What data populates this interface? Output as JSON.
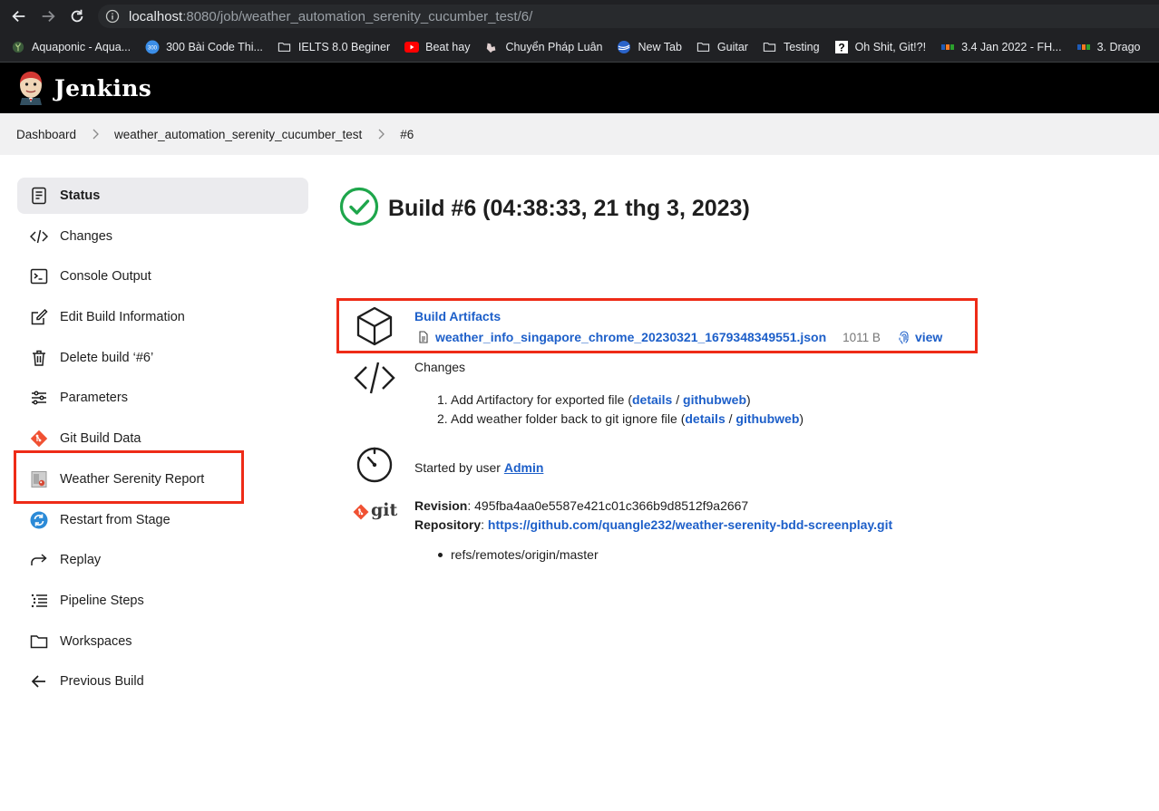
{
  "browser": {
    "url_host": "localhost",
    "url_rest": ":8080/job/weather_automation_serenity_cucumber_test/6/",
    "bookmarks": [
      {
        "label": "Aquaponic - Aqua...",
        "icon": "plant-icon"
      },
      {
        "label": "300 Bài Code Thi...",
        "icon": "300-badge-icon"
      },
      {
        "label": "IELTS 8.0 Beginer",
        "icon": "folder-icon"
      },
      {
        "label": "Beat hay",
        "icon": "youtube-icon"
      },
      {
        "label": "Chuyển Pháp Luân",
        "icon": "falun-icon"
      },
      {
        "label": "New Tab",
        "icon": "globe-icon"
      },
      {
        "label": "Guitar",
        "icon": "folder-icon"
      },
      {
        "label": "Testing",
        "icon": "folder-icon"
      },
      {
        "label": "Oh Shit, Git!?!",
        "icon": "question-icon"
      },
      {
        "label": "3.4 Jan 2022 - FH...",
        "icon": "fpt-icon"
      },
      {
        "label": "3. Drago",
        "icon": "fpt-icon"
      }
    ]
  },
  "header": {
    "title": "Jenkins"
  },
  "breadcrumb": {
    "items": [
      "Dashboard",
      "weather_automation_serenity_cucumber_test",
      "#6"
    ]
  },
  "sidebar": {
    "items": [
      {
        "label": "Status",
        "icon": "status-icon"
      },
      {
        "label": "Changes",
        "icon": "code-icon"
      },
      {
        "label": "Console Output",
        "icon": "terminal-icon"
      },
      {
        "label": "Edit Build Information",
        "icon": "edit-icon"
      },
      {
        "label": "Delete build ‘#6’",
        "icon": "trash-icon"
      },
      {
        "label": "Parameters",
        "icon": "sliders-icon"
      },
      {
        "label": "Git Build Data",
        "icon": "git-icon"
      },
      {
        "label": "Weather Serenity Report",
        "icon": "report-icon"
      },
      {
        "label": "Restart from Stage",
        "icon": "restart-icon"
      },
      {
        "label": "Replay",
        "icon": "replay-icon"
      },
      {
        "label": "Pipeline Steps",
        "icon": "list-icon"
      },
      {
        "label": "Workspaces",
        "icon": "folder-icon"
      },
      {
        "label": "Previous Build",
        "icon": "arrow-left-icon"
      }
    ]
  },
  "build": {
    "title": "Build #6 (04:38:33, 21 thg 3, 2023)",
    "status_color": "#1ea64b"
  },
  "artifacts": {
    "title": "Build Artifacts",
    "file": "weather_info_singapore_chrome_20230321_1679348349551.json",
    "size": "1011 B",
    "view": "view"
  },
  "changes": {
    "title": "Changes",
    "items": [
      {
        "num": "1.",
        "text": "Add Artifactory for exported file (",
        "details": "details",
        "sep": " / ",
        "githubweb": "githubweb",
        "close": ")"
      },
      {
        "num": "2.",
        "text": "Add weather folder back to git ignore file (",
        "details": "details",
        "sep": " / ",
        "githubweb": "githubweb",
        "close": ")"
      }
    ]
  },
  "started": {
    "prefix": "Started by user ",
    "user": "Admin"
  },
  "git": {
    "logo_text": "git",
    "revision_label": "Revision",
    "revision": ": 495fba4aa0e5587e421c01c366b9d8512f9a2667",
    "repository_label": "Repository",
    "repository_sep": ": ",
    "repository": "https://github.com/quangle232/weather-serenity-bdd-screenplay.git",
    "branches": [
      "refs/remotes/origin/master"
    ]
  },
  "colors": {
    "link": "#1d5fc9",
    "highlight": "#ee2b17",
    "header_bg": "#000000"
  }
}
